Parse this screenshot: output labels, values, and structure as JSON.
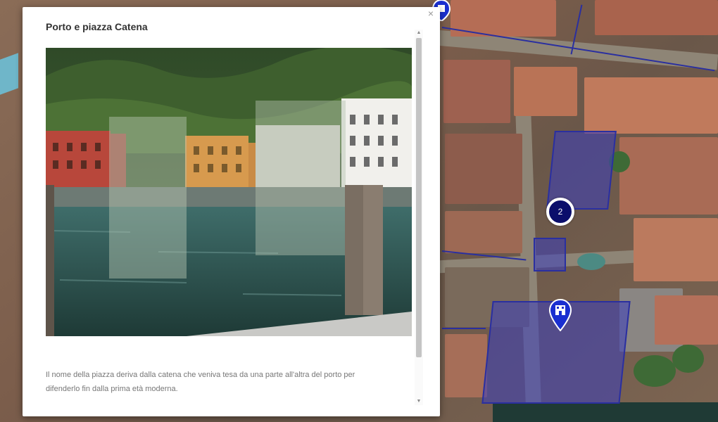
{
  "popup": {
    "title": "Porto e piazza Catena",
    "close_symbol": "×",
    "photo_alt": "Porto e piazza Catena",
    "description": "Il nome della piazza deriva dalla catena che veniva tesa da una parte all'altra del porto per difenderlo fin dalla prima età moderna.",
    "scroll_up": "▲",
    "scroll_down": "▼",
    "scroll_position": 0.0
  },
  "map": {
    "poi_marker_label": "2",
    "poi_marker_icon": "info-circle-icon",
    "pin_icon": "building-pin-icon",
    "highlight_color": "#2a2fa0"
  }
}
